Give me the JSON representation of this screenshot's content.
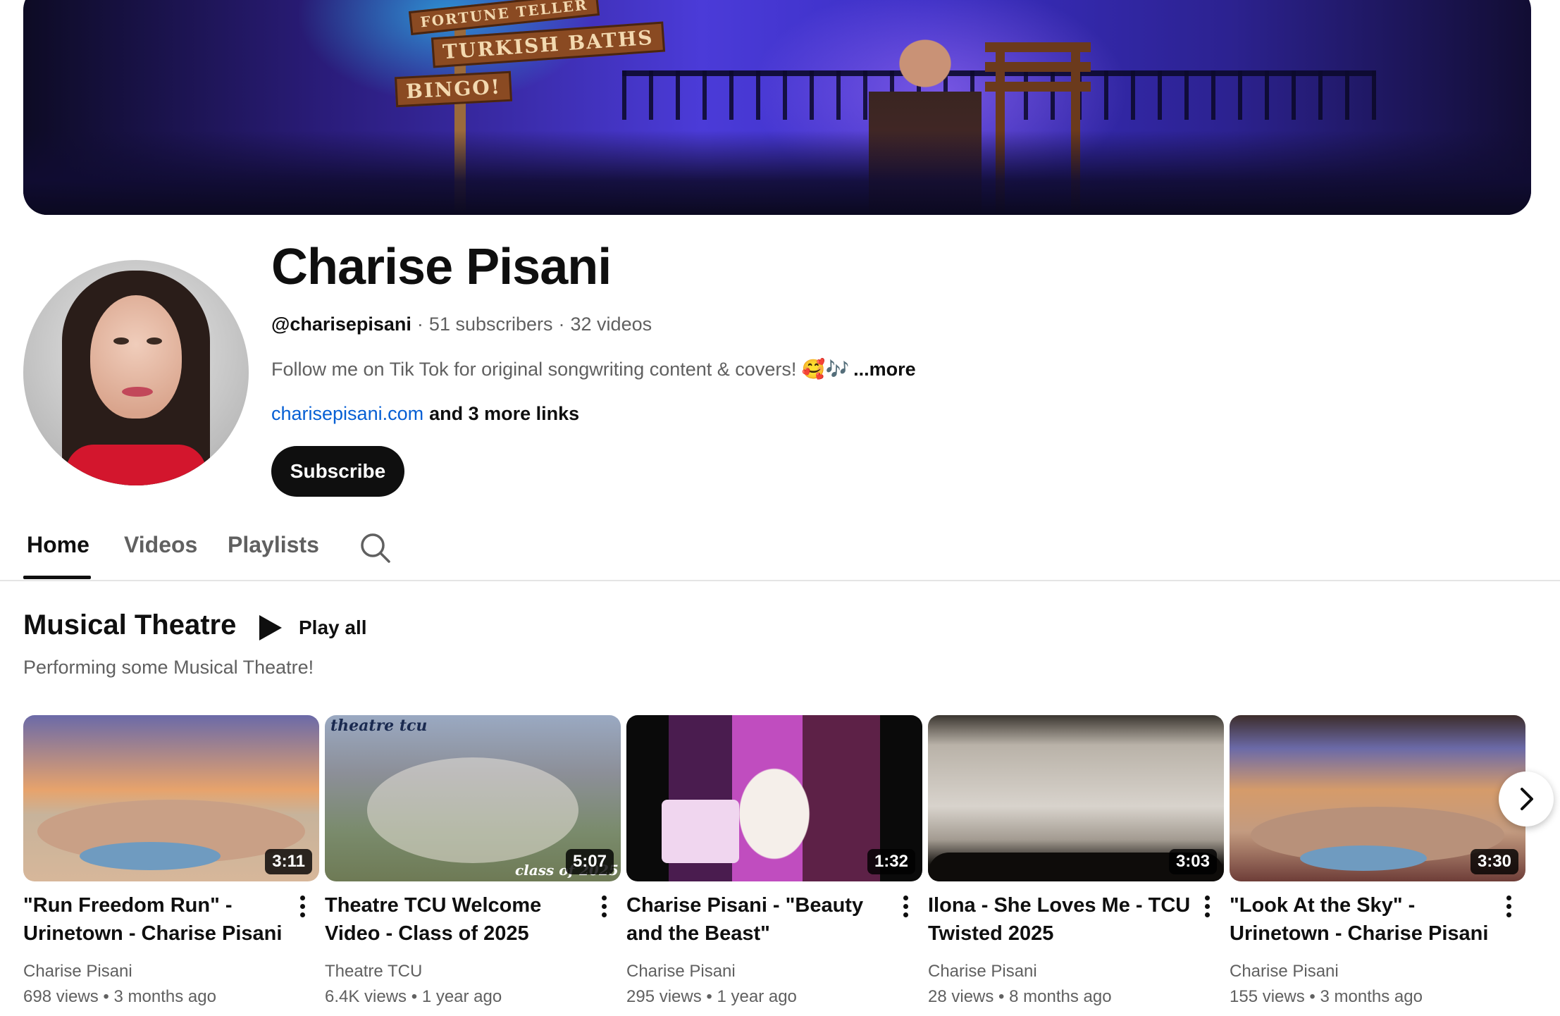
{
  "channel": {
    "name": "Charise Pisani",
    "handle": "@charisepisani",
    "subscribers": "51 subscribers",
    "videos": "32 videos",
    "description": "Follow me on Tik Tok for original songwriting content & covers! 🥰🎶",
    "more_label": "...more",
    "link_text": "charisepisani.com",
    "more_links": "and 3 more links",
    "subscribe_label": "Subscribe"
  },
  "banner": {
    "signs": [
      "FORTUNE TELLER",
      "TURKISH BATHS",
      "BINGO!"
    ]
  },
  "tabs": [
    {
      "label": "Home",
      "active": true
    },
    {
      "label": "Videos",
      "active": false
    },
    {
      "label": "Playlists",
      "active": false
    }
  ],
  "shelf": {
    "title": "Musical Theatre",
    "play_all": "Play all",
    "subtitle": "Performing some Musical Theatre!",
    "videos": [
      {
        "title": "\"Run Freedom Run\" - Urinetown - Charise Pisani",
        "duration": "3:11",
        "channel": "Charise Pisani",
        "views": "698 views",
        "age": "3 months ago"
      },
      {
        "title": "Theatre TCU Welcome Video - Class of 2025",
        "duration": "5:07",
        "channel": "Theatre TCU",
        "views": "6.4K views",
        "age": "1 year ago",
        "overlay_top": "theatre tcu",
        "overlay_bottom": "class of 2025"
      },
      {
        "title": "Charise Pisani - \"Beauty and the Beast\"",
        "duration": "1:32",
        "channel": "Charise Pisani",
        "views": "295 views",
        "age": "1 year ago"
      },
      {
        "title": "Ilona - She Loves Me - TCU Twisted 2025",
        "duration": "3:03",
        "channel": "Charise Pisani",
        "views": "28 views",
        "age": "8 months ago"
      },
      {
        "title": "\"Look At the Sky\" - Urinetown - Charise Pisani",
        "duration": "3:30",
        "channel": "Charise Pisani",
        "views": "155 views",
        "age": "3 months ago"
      }
    ]
  },
  "colors": {
    "text": "#0f0f0f",
    "secondary": "#606060",
    "link": "#065fd4",
    "subscribe_bg": "#0f0f0f"
  },
  "icons": {
    "search": "search-icon",
    "play": "play-icon",
    "more": "more-vert-icon",
    "next": "chevron-right-icon"
  }
}
